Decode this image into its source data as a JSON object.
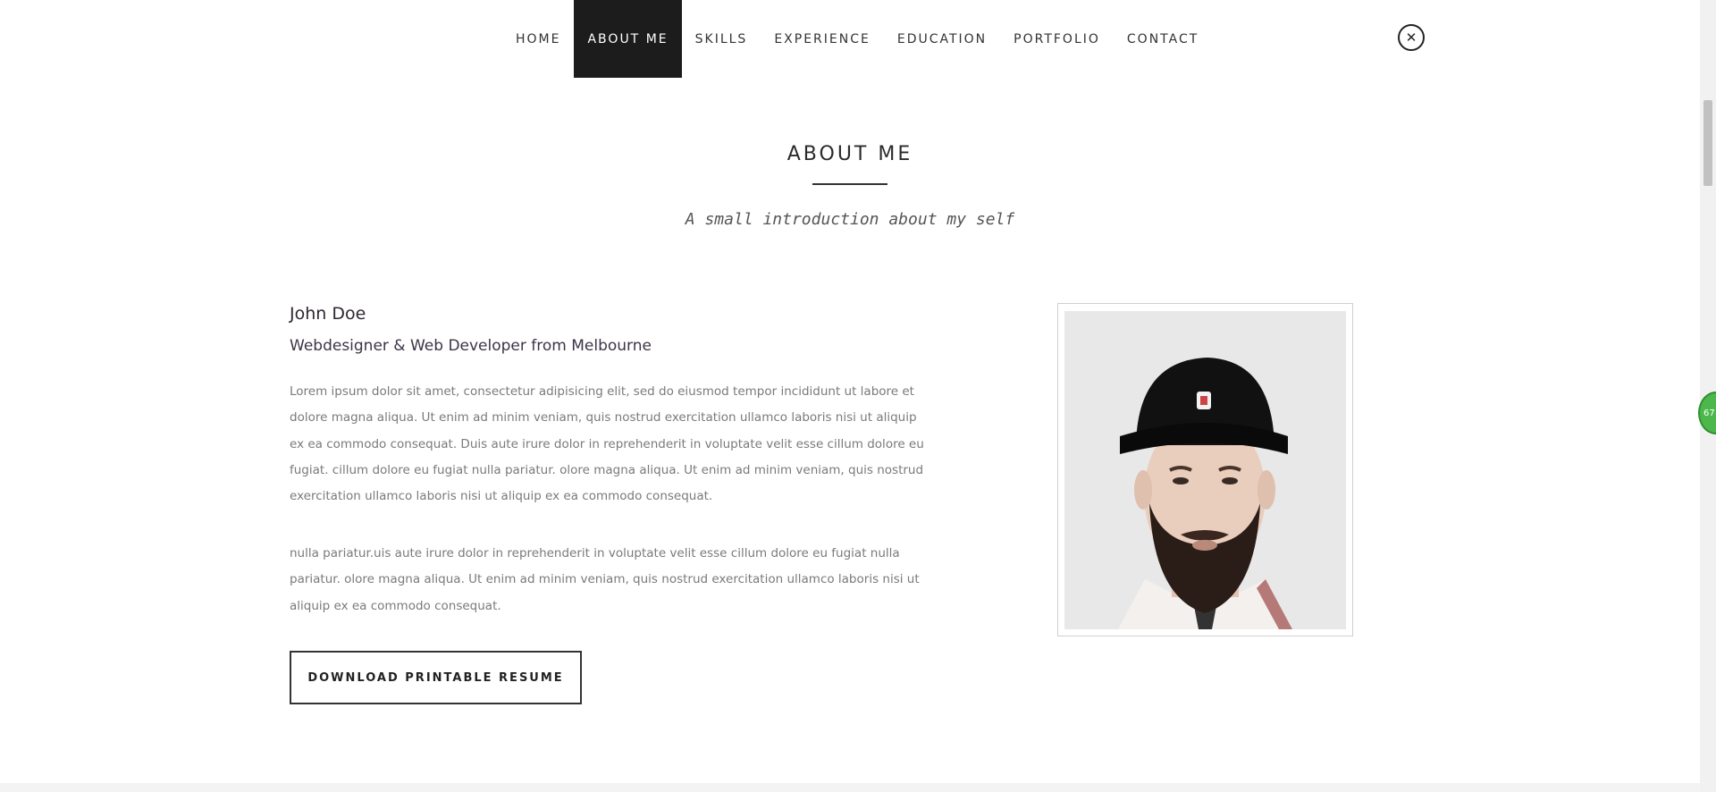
{
  "nav": {
    "items": [
      {
        "label": "HOME"
      },
      {
        "label": "ABOUT ME",
        "active": true
      },
      {
        "label": "SKILLS"
      },
      {
        "label": "EXPERIENCE"
      },
      {
        "label": "EDUCATION"
      },
      {
        "label": "PORTFOLIO"
      },
      {
        "label": "CONTACT"
      }
    ],
    "close_icon": "close-icon"
  },
  "section": {
    "title": "ABOUT ME",
    "subtitle": "A small introduction about my self"
  },
  "profile": {
    "name": "John Doe",
    "role": "Webdesigner & Web Developer from Melbourne",
    "paragraph1": "Lorem ipsum dolor sit amet, consectetur adipisicing elit, sed do eiusmod tempor incididunt ut labore et dolore magna aliqua. Ut enim ad minim veniam, quis nostrud exercitation ullamco laboris nisi ut aliquip ex ea commodo consequat. Duis aute irure dolor in reprehenderit in voluptate velit esse cillum dolore eu fugiat. cillum dolore eu fugiat nulla pariatur. olore magna aliqua. Ut enim ad minim veniam, quis nostrud exercitation ullamco laboris nisi ut aliquip ex ea commodo consequat.",
    "paragraph2": "nulla pariatur.uis aute irure dolor in reprehenderit in voluptate velit esse cillum dolore eu fugiat nulla pariatur. olore magna aliqua. Ut enim ad minim veniam, quis nostrud exercitation ullamco laboris nisi ut aliquip ex ea commodo consequat.",
    "resume_button": "DOWNLOAD PRINTABLE RESUME",
    "photo_icon": "profile-photo"
  },
  "side_badge": "67",
  "colors": {
    "active_nav_bg": "#1c1c1c",
    "text": "#7a7a7a",
    "badge": "#4cb84c"
  }
}
